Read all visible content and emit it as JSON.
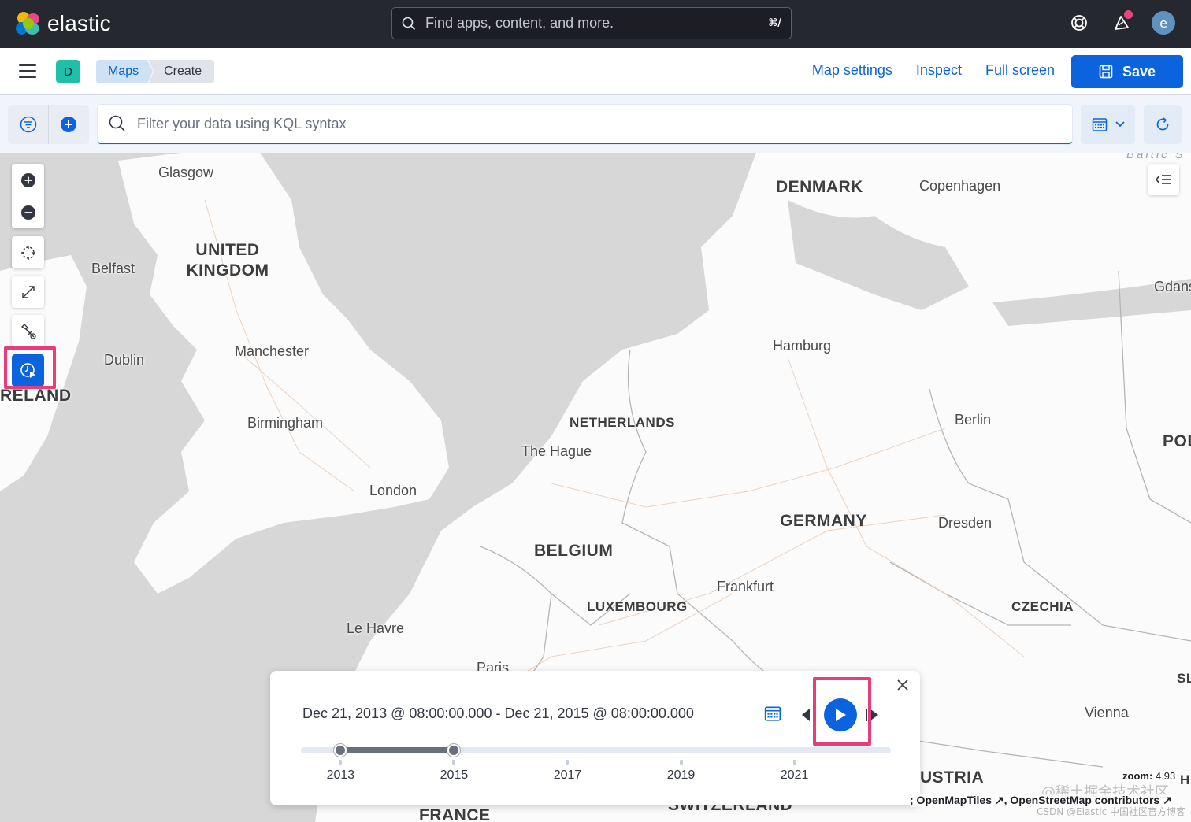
{
  "app": {
    "brand": "elastic",
    "brand_color": "#0b64dd"
  },
  "global_search": {
    "placeholder": "Find apps, content, and more.",
    "shortcut": "⌘/"
  },
  "user": {
    "avatar_initial": "e"
  },
  "subheader": {
    "space_initial": "D",
    "breadcrumbs": [
      "Maps",
      "Create"
    ],
    "links": [
      "Map settings",
      "Inspect",
      "Full screen"
    ],
    "save_label": "Save"
  },
  "query": {
    "placeholder": "Filter your data using KQL syntax"
  },
  "map": {
    "cities": [
      "Glasgow",
      "Belfast",
      "Dublin",
      "Manchester",
      "Birmingham",
      "London",
      "Le Havre",
      "Paris",
      "The Hague",
      "Hamburg",
      "Copenhagen",
      "Berlin",
      "Dresden",
      "Frankfurt",
      "Vienna",
      "Gdans"
    ],
    "countries": [
      "UNITED KINGDOM",
      "DENMARK",
      "NETHERLANDS",
      "BELGIUM",
      "GERMANY",
      "LUXEMBOURG",
      "CZECHIA",
      "FRANCE",
      "SWITZERLAND",
      "USTRIA",
      "RELAND",
      "POL",
      "SL",
      "H"
    ],
    "sea": "Baltic S",
    "zoom_label": "zoom:",
    "zoom_value": "4.93",
    "attribution": "; OpenMapTiles ↗, OpenStreetMap contributors ↗"
  },
  "timeslider": {
    "range_text": "Dec 21, 2013 @ 08:00:00.000 - Dec 21, 2015 @ 08:00:00.000",
    "ticks": [
      "2013",
      "2015",
      "2017",
      "2019",
      "2021"
    ],
    "min_year": 2012.3,
    "max_year": 2022.7,
    "range_start": 2013.0,
    "range_end": 2015.0
  },
  "watermark": {
    "line1": "@稀土掘金技术社区",
    "line2": "CSDN @Elastic 中国社区官方博客"
  }
}
